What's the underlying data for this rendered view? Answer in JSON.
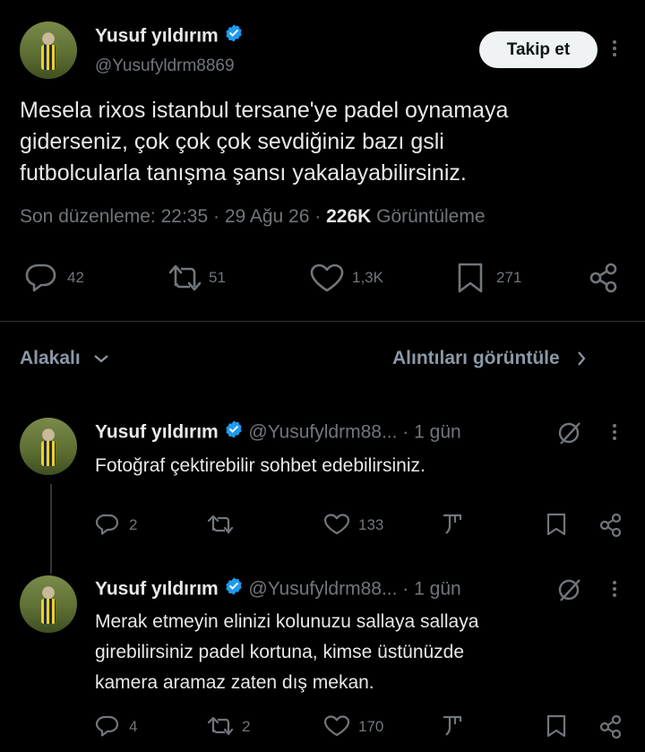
{
  "main_tweet": {
    "author_name": "Yusuf yıldırım",
    "handle": "@Yusufyldrm8869",
    "follow_label": "Takip et",
    "text_lines": [
      "Mesela rixos istanbul tersane'ye padel oynamaya",
      "giderseniz, çok çok çok sevdiğiniz bazı gsli",
      "futbolcularla tanışma şansı yakalayabilirsiniz."
    ],
    "meta_edited": "Son düzenleme: 22:35 · 29 Ağu 26 ·",
    "views_count": "226K",
    "views_label": "Görüntüleme",
    "replies": "42",
    "retweets": "51",
    "likes": "1,3K",
    "bookmarks": "271"
  },
  "replies_header": {
    "sort_label": "Alakalı",
    "quotes_label": "Alıntıları görüntüle"
  },
  "replies": [
    {
      "author_name": "Yusuf yıldırım",
      "handle": "@Yusufyldrm88...",
      "time": "· 1 gün",
      "text_lines": [
        "Fotoğraf çektirebilir sohbet edebilirsiniz."
      ],
      "replies": "2",
      "retweets": "",
      "likes": "133"
    },
    {
      "author_name": "Yusuf yıldırım",
      "handle": "@Yusufyldrm88...",
      "time": "· 1 gün",
      "text_lines": [
        "Merak etmeyin elinizi kolunuzu sallaya sallaya",
        "girebilirsiniz padel kortuna, kimse üstünüzde",
        "kamera aramaz zaten dış mekan."
      ],
      "replies": "4",
      "retweets": "2",
      "likes": "170"
    }
  ],
  "colors": {
    "background": "#000000",
    "text": "#e7e9ea",
    "muted": "#71767b",
    "verified": "#1d9bf0",
    "divider": "#2f3336"
  }
}
